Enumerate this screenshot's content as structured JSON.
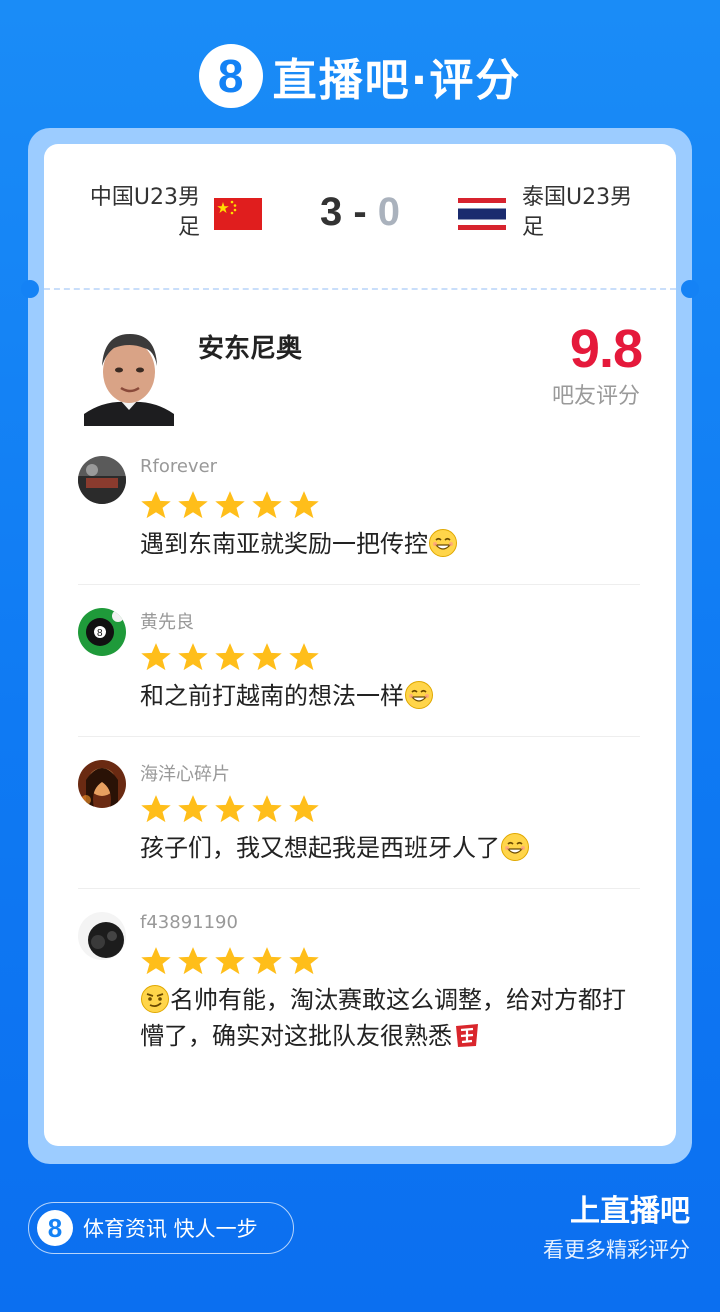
{
  "brand": {
    "logo_glyph": "8",
    "title": "直播吧·评分"
  },
  "match": {
    "home_team": "中国U23男足",
    "away_team": "泰国U23男足",
    "home_score": "3",
    "separator": "-",
    "away_score": "0"
  },
  "player": {
    "name": "安东尼奥",
    "rating": "9.8",
    "rating_label": "吧友评分"
  },
  "comments": [
    {
      "user": "Rforever",
      "stars": 5,
      "text": "遇到东南亚就奖励一把传控",
      "emoji_after": "grin-emoji"
    },
    {
      "user": "黄先良",
      "stars": 5,
      "text": "和之前打越南的想法一样",
      "emoji_after": "grin-emoji"
    },
    {
      "user": "海洋心碎片",
      "stars": 5,
      "text": "孩子们，我又想起我是西班牙人了",
      "emoji_after": "grin-emoji"
    },
    {
      "user": "f43891190",
      "stars": 5,
      "emoji_before": "smirk-emoji",
      "text": "名帅有能，淘汰赛敢这么调整，给对方都打懵了，确实对这批队友很熟悉",
      "emoji_after": "qiong-sticker"
    }
  ],
  "footer": {
    "logo_glyph": "8",
    "slogan": "体育资讯 快人一步",
    "cta_title": "上直播吧",
    "cta_subtitle": "看更多精彩评分"
  },
  "colors": {
    "brand_blue": "#1482f5",
    "rating_red": "#e5193b",
    "star_gold": "#ffbe1a",
    "frame_blue": "#9cccff"
  }
}
